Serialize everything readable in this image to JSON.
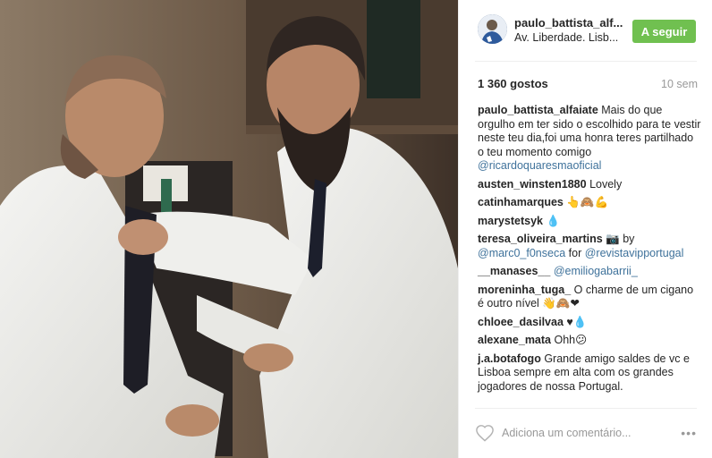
{
  "header": {
    "username": "paulo_battista_alf...",
    "location": "Av. Liberdade. Lisb...",
    "follow_label": "A seguir"
  },
  "stats": {
    "likes": "1 360 gostos",
    "time": "10 sem"
  },
  "comments": [
    {
      "user": "paulo_battista_alfaiate",
      "text": "Mais do que orgulho em ter sido o escolhido para te vestir neste teu dia,foi uma honra teres partilhado o teu momento comigo",
      "link": "@ricardoquaresmaoficial"
    },
    {
      "user": "austen_winsten1880",
      "text": "Lovely"
    },
    {
      "user": "catinhamarques",
      "text": "👆🙈💪"
    },
    {
      "user": "marystetsyk",
      "text": "💧"
    },
    {
      "user": "teresa_oliveira_martins",
      "text": "📷 by",
      "link": "@marc0_f0nseca",
      "text2": "for",
      "link2": "@revistavipportugal"
    },
    {
      "user": "__manases__",
      "link": "@emiliogabarrii_"
    },
    {
      "user": "moreninha_tuga_",
      "text": "O charme de um cigano é outro nível 👋🙈❤"
    },
    {
      "user": "chloee_dasilvaa",
      "text": "♥💧"
    },
    {
      "user": "alexane_mata",
      "text": "Ohh😕"
    },
    {
      "user": "j.a.botafogo",
      "text": "Grande amigo saldes de vc e Lisboa sempre em alta com os grandes jogadores de nossa Portugal."
    }
  ],
  "footer": {
    "comment_placeholder": "Adiciona um comentário...",
    "more_label": "•••"
  },
  "icons": {
    "like": "heart-outline-icon",
    "more": "more-options-icon"
  },
  "colors": {
    "follow_button": "#70c050",
    "link": "#3f729b",
    "muted": "#999999"
  }
}
